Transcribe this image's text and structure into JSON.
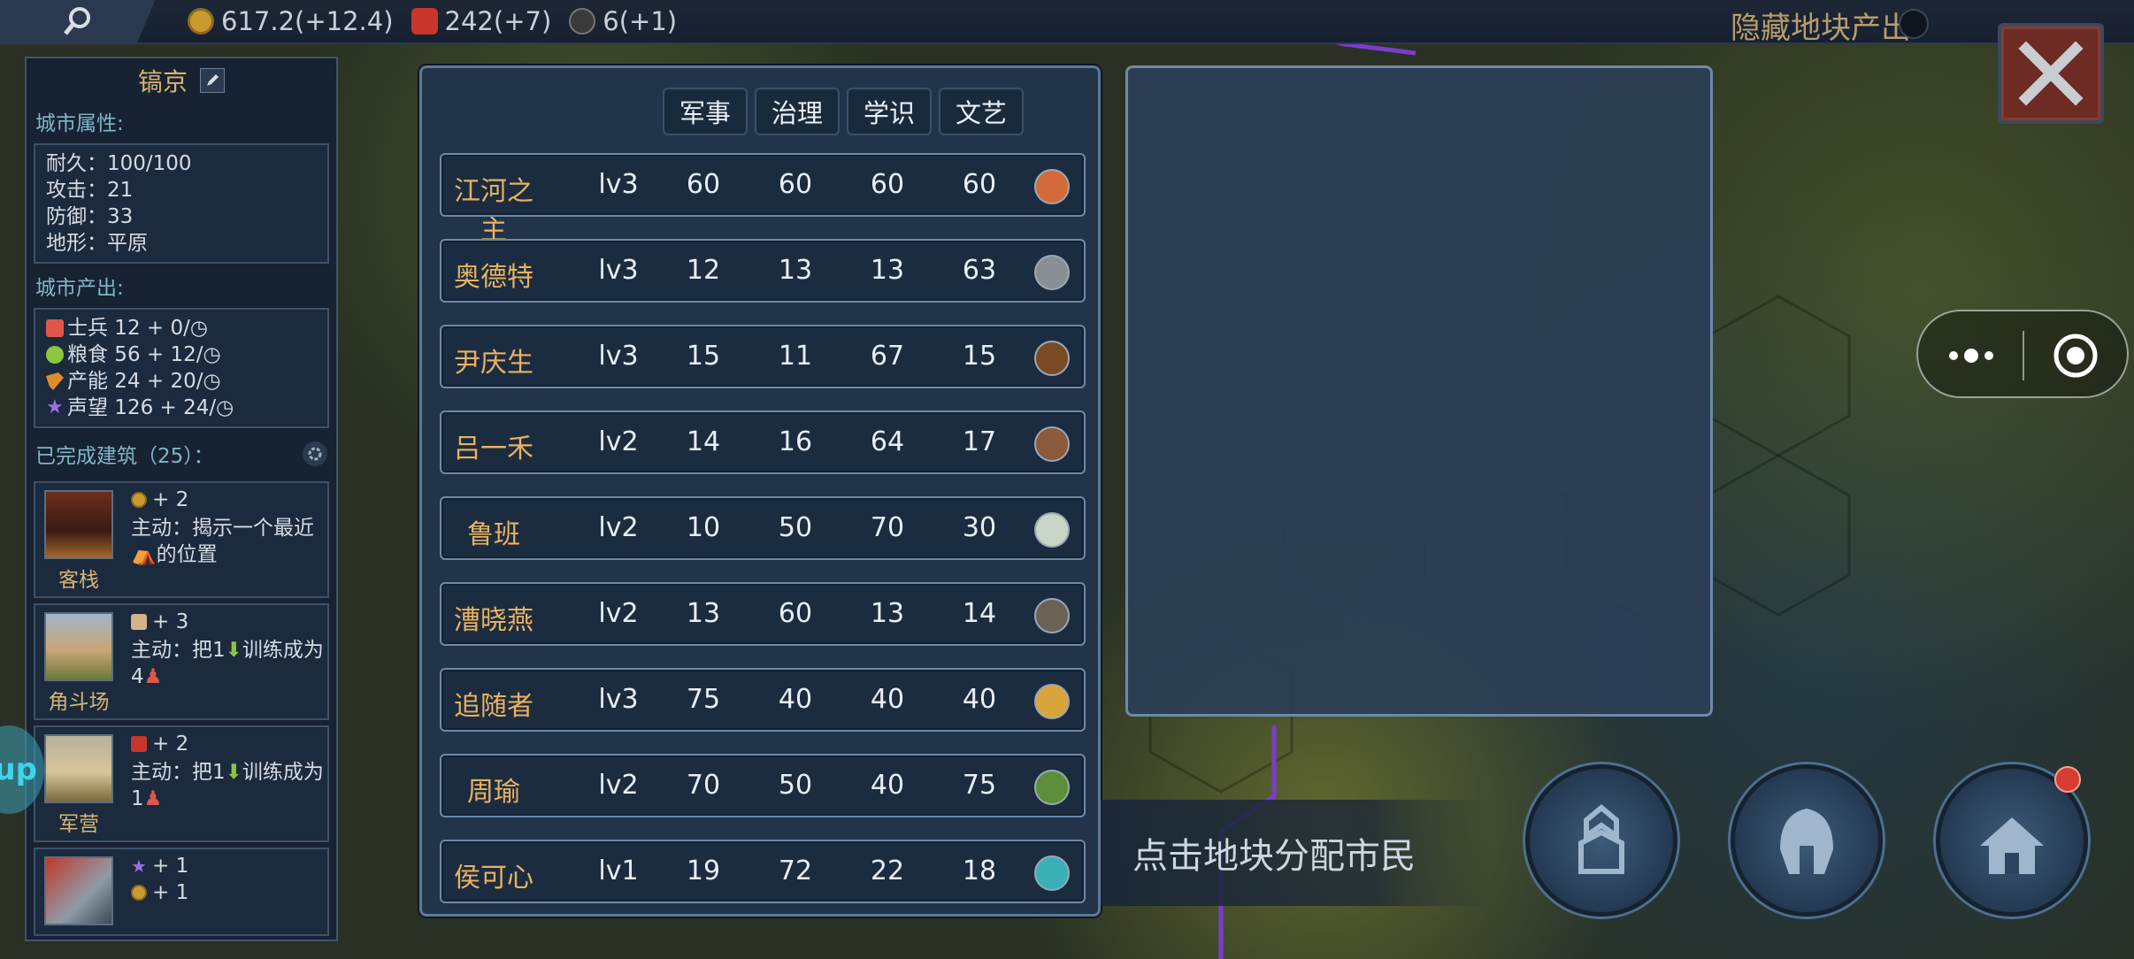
{
  "topbar": {
    "gold": "617.2(+12.4)",
    "soldiers": "242(+7)",
    "generals": "6(+1)",
    "hide_yield_label": "隐藏地块产出"
  },
  "city": {
    "name": "镐京",
    "attr_title": "城市属性:",
    "attrs": [
      "耐久：100/100",
      "攻击：21",
      "防御：33",
      "地形：平原"
    ],
    "prod_title": "城市产出:",
    "prod": [
      {
        "label": "士兵 12 + 0/",
        "color": "#e0574a"
      },
      {
        "label": "粮食 56 + 12/",
        "color": "#8cc63f"
      },
      {
        "label": "产能 24 + 20/",
        "color": "#e08a2c"
      },
      {
        "label": "声望 126 + 24/",
        "color": "#9b6fe6"
      }
    ],
    "done_title": "已完成建筑（25）：",
    "buildings": [
      {
        "name": "客栈",
        "bonus": "+ 2",
        "desc": "主动：揭示一个最近",
        "desc2": "的位置"
      },
      {
        "name": "角斗场",
        "bonus": "+ 3",
        "desc": "主动：把1",
        "desc2": "训练成为4"
      },
      {
        "name": "军营",
        "bonus": "+ 2",
        "desc": "主动：把1",
        "desc2": "训练成为1"
      },
      {
        "name": "",
        "bonus": "+ 1",
        "bonus2": "+ 1",
        "desc": "",
        "desc2": ""
      }
    ]
  },
  "table": {
    "headers": [
      "军事",
      "治理",
      "学识",
      "文艺"
    ],
    "rows": [
      {
        "name": "江河之主",
        "lv": "lv3",
        "s": [
          "60",
          "60",
          "60",
          "60"
        ],
        "av": "#d46a3a"
      },
      {
        "name": "奥德特",
        "lv": "lv3",
        "s": [
          "12",
          "13",
          "13",
          "63"
        ],
        "av": "#8a8f96"
      },
      {
        "name": "尹庆生",
        "lv": "lv3",
        "s": [
          "15",
          "11",
          "67",
          "15"
        ],
        "av": "#7a4a22"
      },
      {
        "name": "吕一禾",
        "lv": "lv2",
        "s": [
          "14",
          "16",
          "64",
          "17"
        ],
        "av": "#8a5a3a"
      },
      {
        "name": "鲁班",
        "lv": "lv2",
        "s": [
          "10",
          "50",
          "70",
          "30"
        ],
        "av": "#c8d6c8"
      },
      {
        "name": "漕晓燕",
        "lv": "lv2",
        "s": [
          "13",
          "60",
          "13",
          "14"
        ],
        "av": "#6b6256"
      },
      {
        "name": "追随者",
        "lv": "lv3",
        "s": [
          "75",
          "40",
          "40",
          "40"
        ],
        "av": "#d9a53a"
      },
      {
        "name": "周瑜",
        "lv": "lv2",
        "s": [
          "70",
          "50",
          "40",
          "75"
        ],
        "av": "#5b8f3a"
      },
      {
        "name": "侯可心",
        "lv": "lv1",
        "s": [
          "19",
          "72",
          "22",
          "18"
        ],
        "av": "#3ab0b8"
      }
    ]
  },
  "hint": "点击地块分配市民",
  "side_tab": "up",
  "colors": {
    "accent_gold": "#e8b25f",
    "panel": "#22344a",
    "border": "#6d8aa6"
  }
}
